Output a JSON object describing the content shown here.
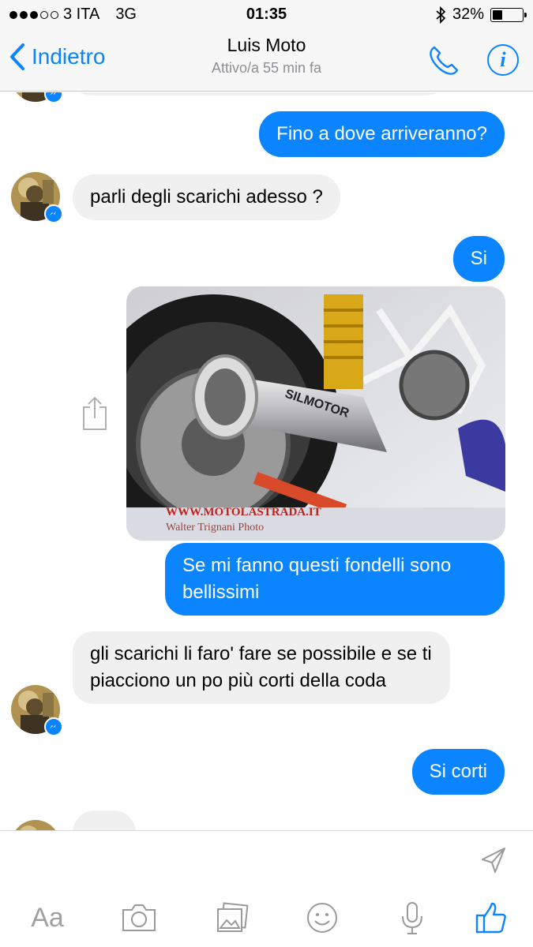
{
  "status_bar": {
    "carrier": "3 ITA",
    "network": "3G",
    "time": "01:35",
    "battery_percent": "32%",
    "battery_level": 0.32,
    "signal_bars_filled": 3,
    "signal_bars_total": 5
  },
  "nav": {
    "back_label": "Indietro",
    "title": "Luis Moto",
    "subtitle": "Attivo/a 55 min fa",
    "call_icon": "phone-icon",
    "info_icon": "info-icon"
  },
  "messages": [
    {
      "direction": "outgoing",
      "text": "Fino a dove arriveranno?"
    },
    {
      "direction": "incoming",
      "text": "parli degli scarichi adesso ?"
    },
    {
      "direction": "outgoing",
      "text": "Si"
    },
    {
      "direction": "outgoing",
      "type": "photo",
      "photo_watermark": "WWW.MOTOLASTRADA.IT",
      "photo_credit": "Walter Trignani Photo",
      "photo_brand": "SILMOTOR"
    },
    {
      "direction": "outgoing",
      "text": "Se mi fanno questi fondelli sono bellissimi"
    },
    {
      "direction": "incoming",
      "text": "gli scarichi li faro' fare se possibile e se ti piacciono un po più corti della coda"
    },
    {
      "direction": "outgoing",
      "text": "Si corti"
    }
  ],
  "composer": {
    "placeholder": "",
    "toolbar": {
      "text_label": "Aa",
      "items": [
        "camera-icon",
        "gallery-icon",
        "emoji-icon",
        "microphone-icon",
        "like-icon"
      ]
    },
    "send_icon": "send-arrow-icon"
  },
  "colors": {
    "accent": "#0a84ff",
    "incoming_bubble": "#f0f0f0",
    "bar_background": "#f7f7f7"
  }
}
